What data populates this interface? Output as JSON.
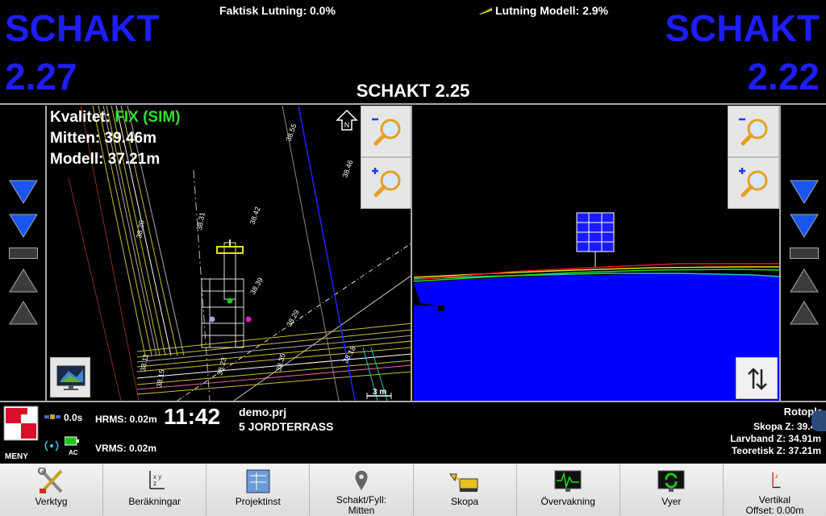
{
  "topbar": {
    "left_label": "SCHAKT",
    "left_value": "2.27",
    "right_label": "SCHAKT",
    "right_value": "2.22",
    "faktisk_lutning": "Faktisk Lutning: 0.0%",
    "lutning_modell": "Lutning Modell: 2.9%",
    "center_depth": "SCHAKT 2.25"
  },
  "plan_view": {
    "kvalitet_label": "Kvalitet: ",
    "kvalitet_value": "FIX (SIM)",
    "mitten": "Mitten: 39.46m",
    "modell": "Modell: 37.21m",
    "north_label": "N",
    "scale_label": "3 m",
    "contour_labels": [
      "38.55",
      "38.46",
      "38.42",
      "38.31",
      "38.20",
      "38.29",
      "38.39",
      "38.35",
      "38.23",
      "38.18",
      "38.15",
      "38.11"
    ]
  },
  "status": {
    "meny": "MENY",
    "age": "0.0s",
    "hrms": "HRMS: 0.02m",
    "vrms": "VRMS: 0.02m",
    "clock": "11:42",
    "ac": "AC",
    "project": "demo.prj",
    "layer": "5 JORDTERRASS",
    "rotoplan": "Rotopla",
    "skopa_z": "Skopa Z: 39.46",
    "larvband_z": "Larvband Z: 34.91m",
    "teoretisk_z": "Teoretisk Z: 37.21m"
  },
  "toolbar": [
    {
      "label": "Verktyg",
      "icon": "tools-icon"
    },
    {
      "label": "Beräkningar",
      "icon": "xyz-axes-icon"
    },
    {
      "label": "Projektinst",
      "icon": "blueprint-icon"
    },
    {
      "label": "Schakt/Fyll:\nMitten",
      "icon": "location-pin-icon"
    },
    {
      "label": "Skopa",
      "icon": "excavator-bucket-icon"
    },
    {
      "label": "Övervakning",
      "icon": "monitor-waveform-icon"
    },
    {
      "label": "Vyer",
      "icon": "monitor-refresh-icon"
    },
    {
      "label": "Vertikal\nOffset: 0.00m",
      "icon": "vertical-offset-icon"
    }
  ],
  "colors": {
    "big_text": "#1d1dff",
    "fix_green": "#2ee02e",
    "ground_blue": "#0000ff"
  }
}
